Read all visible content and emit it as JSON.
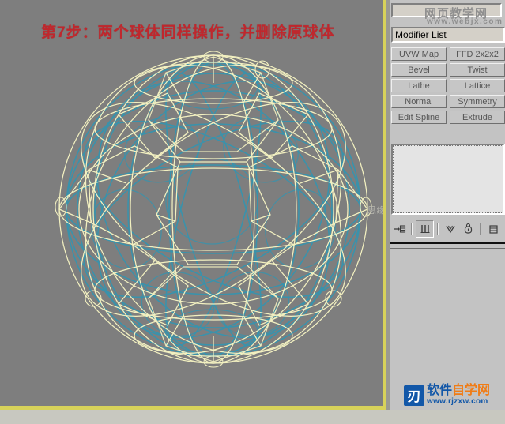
{
  "viewport": {
    "step_title": "第7步：两个球体同样操作，并删除原球体",
    "watermark": "思缘设计论坛  WWW.MISSYUAN.COM",
    "background_color": "#7e7e7e",
    "active_border_color": "#d7d25a",
    "wireframe_primary_color": "#f2f0c0",
    "wireframe_secondary_color": "#2f96b4"
  },
  "panel": {
    "name_field_value": "",
    "modifier_list_label": "Modifier List",
    "watermark_cn": "网页教学网",
    "watermark_url": "www.webjx.com",
    "buttons": [
      {
        "left": "UVW Map",
        "right": "FFD 2x2x2"
      },
      {
        "left": "Bevel",
        "right": "Twist"
      },
      {
        "left": "Lathe",
        "right": "Lattice"
      },
      {
        "left": "Normal",
        "right": "Symmetry"
      },
      {
        "left": "Edit Spline",
        "right": "Extrude"
      }
    ],
    "stack_items": [],
    "toolbar_icons": [
      {
        "name": "pin-stack-icon",
        "glyph": "⊸",
        "pressed": false
      },
      {
        "name": "show-end-result-icon",
        "glyph": "⌷",
        "pressed": true
      },
      {
        "name": "make-unique-icon",
        "glyph": "⩔",
        "pressed": false
      },
      {
        "name": "remove-modifier-icon",
        "glyph": "⌸",
        "pressed": false
      },
      {
        "name": "configure-sets-icon",
        "glyph": "▤",
        "pressed": false
      }
    ]
  },
  "footer": {
    "logo_mark": "刃",
    "logo_cn_blue": "软件",
    "logo_cn_orange": "自学网",
    "logo_url": "www.rjzxw.com"
  }
}
